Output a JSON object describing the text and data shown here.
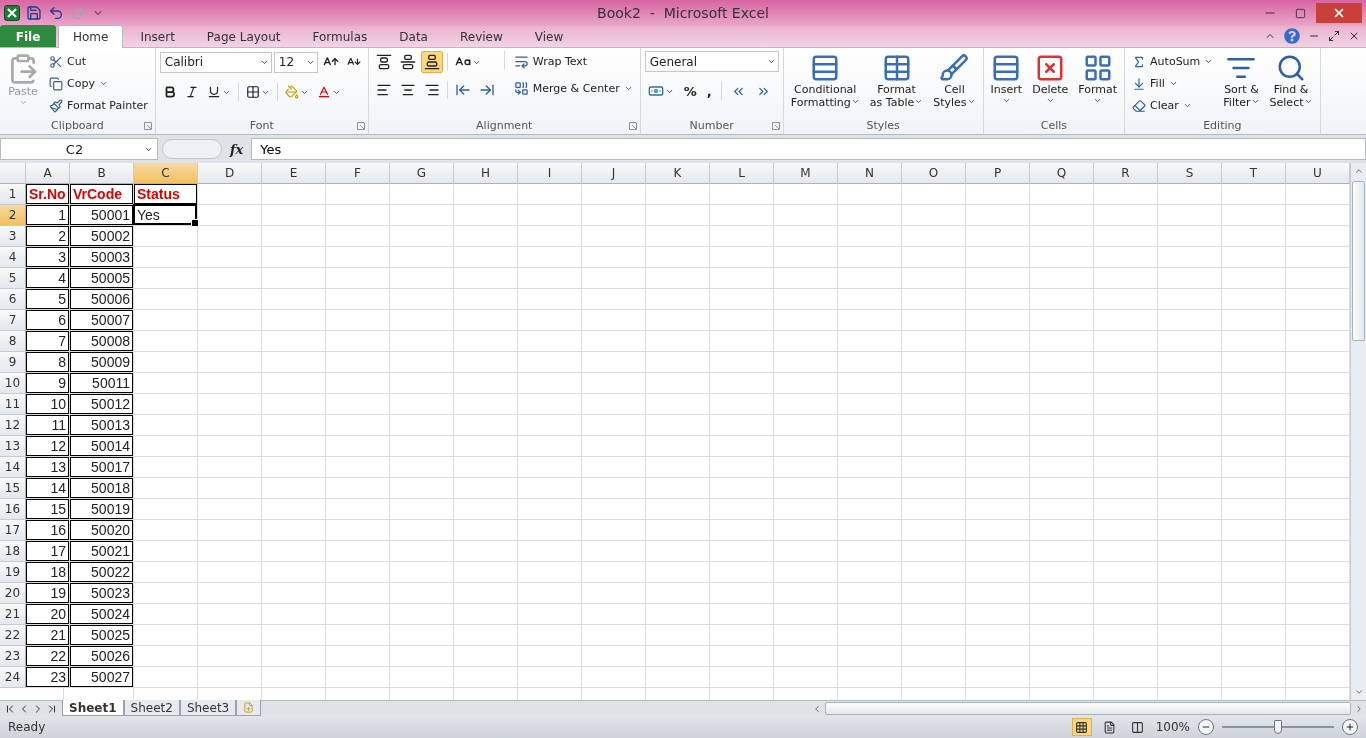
{
  "title_bar": {
    "title": "Book2  -  Microsoft Excel"
  },
  "tabs": [
    {
      "label": "File",
      "kind": "file",
      "selected": false
    },
    {
      "label": "Home",
      "kind": "tab",
      "selected": true
    },
    {
      "label": "Insert",
      "kind": "tab",
      "selected": false
    },
    {
      "label": "Page Layout",
      "kind": "tab",
      "selected": false
    },
    {
      "label": "Formulas",
      "kind": "tab",
      "selected": false
    },
    {
      "label": "Data",
      "kind": "tab",
      "selected": false
    },
    {
      "label": "Review",
      "kind": "tab",
      "selected": false
    },
    {
      "label": "View",
      "kind": "tab",
      "selected": false
    }
  ],
  "ribbon": {
    "clipboard": {
      "label": "Clipboard",
      "paste": {
        "label": "Paste",
        "disabled": true
      },
      "tools": [
        {
          "label": "Cut",
          "dropdown": false
        },
        {
          "label": "Copy",
          "dropdown": true
        },
        {
          "label": "Format Painter",
          "dropdown": false
        }
      ]
    },
    "font": {
      "label": "Font",
      "face": "Calibri",
      "size": "12"
    },
    "alignment": {
      "label": "Alignment",
      "vertical": [
        {
          "selected": false
        },
        {
          "selected": false
        },
        {
          "selected": true
        }
      ],
      "wrap": "Wrap Text",
      "merge": "Merge & Center"
    },
    "number": {
      "label": "Number",
      "format": "General",
      "symbols": [
        "%",
        ","
      ]
    },
    "styles": {
      "label": "Styles",
      "buttons": [
        "Conditional\nFormatting",
        "Format\nas Table",
        "Cell\nStyles"
      ]
    },
    "cells": {
      "label": "Cells",
      "buttons": [
        "Insert",
        "Delete",
        "Format"
      ]
    },
    "editing": {
      "label": "Editing",
      "tools": [
        "AutoSum",
        "Fill",
        "Clear"
      ],
      "buttons": [
        "Sort &\nFilter",
        "Find &\nSelect"
      ]
    }
  },
  "formula_bar": {
    "name_box": "C2",
    "function_label": "fx",
    "value": "Yes"
  },
  "sheet": {
    "columns": [
      {
        "label": "A",
        "selected": false
      },
      {
        "label": "B",
        "selected": false
      },
      {
        "label": "C",
        "selected": true
      },
      {
        "label": "D",
        "selected": false
      },
      {
        "label": "E",
        "selected": false
      },
      {
        "label": "F",
        "selected": false
      },
      {
        "label": "G",
        "selected": false
      },
      {
        "label": "H",
        "selected": false
      },
      {
        "label": "I",
        "selected": false
      },
      {
        "label": "J",
        "selected": false
      },
      {
        "label": "K",
        "selected": false
      },
      {
        "label": "L",
        "selected": false
      },
      {
        "label": "M",
        "selected": false
      },
      {
        "label": "N",
        "selected": false
      },
      {
        "label": "O",
        "selected": false
      },
      {
        "label": "P",
        "selected": false
      },
      {
        "label": "Q",
        "selected": false
      },
      {
        "label": "R",
        "selected": false
      },
      {
        "label": "S",
        "selected": false
      },
      {
        "label": "T",
        "selected": false
      },
      {
        "label": "U",
        "selected": false
      }
    ],
    "rows": [
      {
        "number": "1",
        "selected": false,
        "cells": [
          {
            "value": "Sr.No",
            "kind": "heading",
            "bordered": true,
            "active": false
          },
          {
            "value": "VrCode",
            "kind": "heading",
            "bordered": true,
            "active": false
          },
          {
            "value": "Status",
            "kind": "heading",
            "bordered": true,
            "active": false
          }
        ]
      },
      {
        "number": "2",
        "selected": true,
        "cells": [
          {
            "value": "1",
            "kind": "number",
            "bordered": true,
            "active": false
          },
          {
            "value": "50001",
            "kind": "number",
            "bordered": true,
            "active": false
          },
          {
            "value": "Yes",
            "kind": "text",
            "bordered": false,
            "active": true
          }
        ]
      },
      {
        "number": "3",
        "selected": false,
        "cells": [
          {
            "value": "2",
            "kind": "number",
            "bordered": true,
            "active": false
          },
          {
            "value": "50002",
            "kind": "number",
            "bordered": true,
            "active": false
          }
        ]
      },
      {
        "number": "4",
        "selected": false,
        "cells": [
          {
            "value": "3",
            "kind": "number",
            "bordered": true,
            "active": false
          },
          {
            "value": "50003",
            "kind": "number",
            "bordered": true,
            "active": false
          }
        ]
      },
      {
        "number": "5",
        "selected": false,
        "cells": [
          {
            "value": "4",
            "kind": "number",
            "bordered": true,
            "active": false
          },
          {
            "value": "50005",
            "kind": "number",
            "bordered": true,
            "active": false
          }
        ]
      },
      {
        "number": "6",
        "selected": false,
        "cells": [
          {
            "value": "5",
            "kind": "number",
            "bordered": true,
            "active": false
          },
          {
            "value": "50006",
            "kind": "number",
            "bordered": true,
            "active": false
          }
        ]
      },
      {
        "number": "7",
        "selected": false,
        "cells": [
          {
            "value": "6",
            "kind": "number",
            "bordered": true,
            "active": false
          },
          {
            "value": "50007",
            "kind": "number",
            "bordered": true,
            "active": false
          }
        ]
      },
      {
        "number": "8",
        "selected": false,
        "cells": [
          {
            "value": "7",
            "kind": "number",
            "bordered": true,
            "active": false
          },
          {
            "value": "50008",
            "kind": "number",
            "bordered": true,
            "active": false
          }
        ]
      },
      {
        "number": "9",
        "selected": false,
        "cells": [
          {
            "value": "8",
            "kind": "number",
            "bordered": true,
            "active": false
          },
          {
            "value": "50009",
            "kind": "number",
            "bordered": true,
            "active": false
          }
        ]
      },
      {
        "number": "10",
        "selected": false,
        "cells": [
          {
            "value": "9",
            "kind": "number",
            "bordered": true,
            "active": false
          },
          {
            "value": "50011",
            "kind": "number",
            "bordered": true,
            "active": false
          }
        ]
      },
      {
        "number": "11",
        "selected": false,
        "cells": [
          {
            "value": "10",
            "kind": "number",
            "bordered": true,
            "active": false
          },
          {
            "value": "50012",
            "kind": "number",
            "bordered": true,
            "active": false
          }
        ]
      },
      {
        "number": "12",
        "selected": false,
        "cells": [
          {
            "value": "11",
            "kind": "number",
            "bordered": true,
            "active": false
          },
          {
            "value": "50013",
            "kind": "number",
            "bordered": true,
            "active": false
          }
        ]
      },
      {
        "number": "13",
        "selected": false,
        "cells": [
          {
            "value": "12",
            "kind": "number",
            "bordered": true,
            "active": false
          },
          {
            "value": "50014",
            "kind": "number",
            "bordered": true,
            "active": false
          }
        ]
      },
      {
        "number": "14",
        "selected": false,
        "cells": [
          {
            "value": "13",
            "kind": "number",
            "bordered": true,
            "active": false
          },
          {
            "value": "50017",
            "kind": "number",
            "bordered": true,
            "active": false
          }
        ]
      },
      {
        "number": "15",
        "selected": false,
        "cells": [
          {
            "value": "14",
            "kind": "number",
            "bordered": true,
            "active": false
          },
          {
            "value": "50018",
            "kind": "number",
            "bordered": true,
            "active": false
          }
        ]
      },
      {
        "number": "16",
        "selected": false,
        "cells": [
          {
            "value": "15",
            "kind": "number",
            "bordered": true,
            "active": false
          },
          {
            "value": "50019",
            "kind": "number",
            "bordered": true,
            "active": false
          }
        ]
      },
      {
        "number": "17",
        "selected": false,
        "cells": [
          {
            "value": "16",
            "kind": "number",
            "bordered": true,
            "active": false
          },
          {
            "value": "50020",
            "kind": "number",
            "bordered": true,
            "active": false
          }
        ]
      },
      {
        "number": "18",
        "selected": false,
        "cells": [
          {
            "value": "17",
            "kind": "number",
            "bordered": true,
            "active": false
          },
          {
            "value": "50021",
            "kind": "number",
            "bordered": true,
            "active": false
          }
        ]
      },
      {
        "number": "19",
        "selected": false,
        "cells": [
          {
            "value": "18",
            "kind": "number",
            "bordered": true,
            "active": false
          },
          {
            "value": "50022",
            "kind": "number",
            "bordered": true,
            "active": false
          }
        ]
      },
      {
        "number": "20",
        "selected": false,
        "cells": [
          {
            "value": "19",
            "kind": "number",
            "bordered": true,
            "active": false
          },
          {
            "value": "50023",
            "kind": "number",
            "bordered": true,
            "active": false
          }
        ]
      },
      {
        "number": "21",
        "selected": false,
        "cells": [
          {
            "value": "20",
            "kind": "number",
            "bordered": true,
            "active": false
          },
          {
            "value": "50024",
            "kind": "number",
            "bordered": true,
            "active": false
          }
        ]
      },
      {
        "number": "22",
        "selected": false,
        "cells": [
          {
            "value": "21",
            "kind": "number",
            "bordered": true,
            "active": false
          },
          {
            "value": "50025",
            "kind": "number",
            "bordered": true,
            "active": false
          }
        ]
      },
      {
        "number": "23",
        "selected": false,
        "cells": [
          {
            "value": "22",
            "kind": "number",
            "bordered": true,
            "active": false
          },
          {
            "value": "50026",
            "kind": "number",
            "bordered": true,
            "active": false
          }
        ]
      },
      {
        "number": "24",
        "selected": false,
        "cells": [
          {
            "value": "23",
            "kind": "number",
            "bordered": true,
            "active": false
          },
          {
            "value": "50027",
            "kind": "number",
            "bordered": true,
            "active": false
          }
        ]
      }
    ]
  },
  "sheet_tabs": [
    {
      "label": "Sheet1",
      "selected": true
    },
    {
      "label": "Sheet2",
      "selected": false
    },
    {
      "label": "Sheet3",
      "selected": false
    }
  ],
  "status_bar": {
    "status": "Ready",
    "views": [
      {
        "selected": true
      },
      {
        "selected": false
      },
      {
        "selected": false
      }
    ],
    "zoom": "100%",
    "zoom_slider": {
      "level": 0.5
    }
  }
}
